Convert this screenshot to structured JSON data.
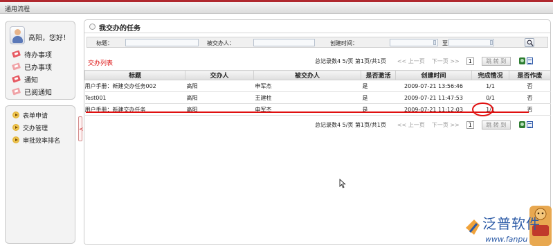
{
  "window": {
    "title": "通用流程"
  },
  "sidebar": {
    "greeting": "高阳，您好！",
    "nav": [
      {
        "label": "待办事项",
        "icon": "mail-icon"
      },
      {
        "label": "已办事项",
        "icon": "mail-icon"
      },
      {
        "label": "通知",
        "icon": "mail-icon"
      },
      {
        "label": "已阅通知",
        "icon": "mail-icon"
      }
    ],
    "menu": [
      {
        "label": "表单申请",
        "icon": "arrow-icon"
      },
      {
        "label": "交办管理",
        "icon": "arrow-icon"
      },
      {
        "label": "审批效率排名",
        "icon": "arrow-icon"
      }
    ],
    "collapse_glyph": "<"
  },
  "main": {
    "heading": "我交办的任务",
    "search": {
      "title_label": "标题：",
      "title_value": "",
      "assignee_label": "被交办人：",
      "assignee_value": "",
      "created_label": "创建时间：",
      "created_from": "",
      "to_label": "至",
      "created_to": ""
    },
    "list_label": "交办列表",
    "pager": {
      "info": "总记录数4  5/页  第1页/共1页",
      "first": "<< 上一页",
      "next": "下一页 >>",
      "page_input": "1",
      "go": "跳 转 到"
    },
    "table": {
      "headers": [
        "标题",
        "交办人",
        "被交办人",
        "是否激活",
        "创建时间",
        "完成情况",
        "是否作废"
      ],
      "rows": [
        [
          "用户手册：新建交办任务002",
          "高阳",
          "申军杰",
          "是",
          "2009-07-21 13:56:46",
          "1/1",
          "否"
        ],
        [
          "Test001",
          "高阳",
          "王建柱",
          "是",
          "2009-07-21 11:47:53",
          "0/1",
          "否"
        ],
        [
          "用户手册：新建交办任务",
          "高阳",
          "申军杰",
          "是",
          "2009-07-21 11:12:03",
          "1/1",
          "否"
        ]
      ]
    }
  },
  "watermark": {
    "brand": "泛普软件",
    "url": "www.fanpu"
  }
}
